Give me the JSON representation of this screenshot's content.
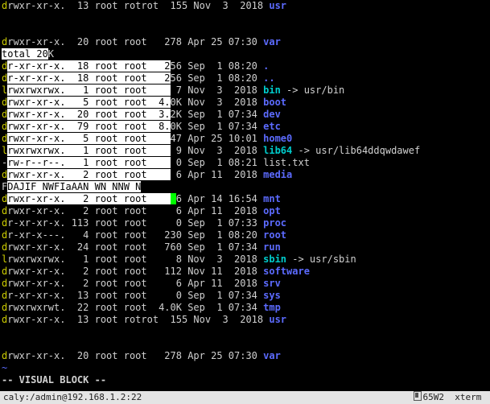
{
  "lines": [
    {
      "type": "dir",
      "d": "d",
      "sel0": false,
      "sel1": false,
      "perm": "rwxr-xr-x.  13 root rotrot  155 Nov  3  2018 ",
      "name": "usr",
      "nl": "blue"
    },
    {
      "type": "blank"
    },
    {
      "type": "blank"
    },
    {
      "type": "dir",
      "d": "d",
      "sel0": false,
      "sel1": false,
      "perm": "rwxr-xr-x.  20 root root   278 Apr 25 07:30 ",
      "name": "var",
      "nl": "blue"
    },
    {
      "type": "total",
      "text": "total 20",
      "sel": true,
      "tail": "K"
    },
    {
      "type": "dir",
      "d": "d",
      "sel0": true,
      "sel1": true,
      "perm": "r-xr-xr-x.  18 root root   2",
      "tail": "56 Sep  1 08:20 ",
      "name": ".",
      "nl": "blue"
    },
    {
      "type": "dir",
      "d": "d",
      "sel0": true,
      "sel1": true,
      "perm": "r-xr-xr-x.  18 root root   2",
      "tail": "56 Sep  1 08:20 ",
      "name": "..",
      "nl": "blue"
    },
    {
      "type": "link",
      "d": "l",
      "sel0": true,
      "sel1": true,
      "perm": "rwxrwxrwx.   1 root root    ",
      "tail": " 7 Nov  3  2018 ",
      "name": "bin",
      "arrow": " -> usr/bin",
      "nl": "cyan"
    },
    {
      "type": "dir",
      "d": "d",
      "sel0": true,
      "sel1": true,
      "perm": "rwxr-xr-x.   5 root root  4.",
      "tail": "0K Nov  3  2018 ",
      "name": "boot",
      "nl": "blue"
    },
    {
      "type": "dir",
      "d": "d",
      "sel0": true,
      "sel1": true,
      "perm": "rwxr-xr-x.  20 root root  3.",
      "tail": "2K Sep  1 07:34 ",
      "name": "dev",
      "nl": "blue"
    },
    {
      "type": "dir",
      "d": "d",
      "sel0": true,
      "sel1": true,
      "perm": "rwxr-xr-x.  79 root root  8.",
      "tail": "0K Sep  1 07:34 ",
      "name": "etc",
      "nl": "blue"
    },
    {
      "type": "dir",
      "d": "d",
      "sel0": true,
      "sel1": true,
      "perm": "rwxr-xr-x.   5 root root    ",
      "tail": "47 Apr 25 10:01 ",
      "name": "home0",
      "nl": "blue"
    },
    {
      "type": "link",
      "d": "l",
      "sel0": true,
      "sel1": true,
      "perm": "rwxrwxrwx.   1 root root    ",
      "tail": " 9 Nov  3  2018 ",
      "name": "lib64",
      "arrow": " -> usr/lib64ddqwdawef",
      "nl": "cyan"
    },
    {
      "type": "file",
      "d": "-",
      "sel0": true,
      "sel1": true,
      "perm": "rw-r--r--.   1 root root    ",
      "tail": " 0 Sep  1 08:21 list.txt"
    },
    {
      "type": "dir",
      "d": "d",
      "sel0": true,
      "sel1": true,
      "perm": "rwxr-xr-x.   2 root root    ",
      "tail": " 6 Apr 11  2018 ",
      "name": "media",
      "nl": "blue"
    },
    {
      "type": "garble",
      "text": "FDAJIF NWFIaAAN WN NNW N",
      "sel": true
    },
    {
      "type": "dir_cursor",
      "d": "d",
      "sel0": true,
      "sel1": true,
      "perm": "rwxr-xr-x.   2 root root    ",
      "curs": " ",
      "tail": "6 Apr 14 16:54 ",
      "name": "mnt",
      "nl": "blue"
    },
    {
      "type": "dir",
      "d": "d",
      "sel0": false,
      "sel1": false,
      "perm": "rwxr-xr-x.   2 root root     6 Apr 11  2018 ",
      "name": "opt",
      "nl": "blue"
    },
    {
      "type": "dir",
      "d": "d",
      "sel0": false,
      "sel1": false,
      "perm": "r-xr-xr-x. 113 root root     0 Sep  1 07:33 ",
      "name": "proc",
      "nl": "blue"
    },
    {
      "type": "dir",
      "d": "d",
      "sel0": false,
      "sel1": false,
      "perm": "r-xr-x---.   4 root root   230 Sep  1 08:20 ",
      "name": "root",
      "nl": "blue"
    },
    {
      "type": "dir",
      "d": "d",
      "sel0": false,
      "sel1": false,
      "perm": "rwxr-xr-x.  24 root root   760 Sep  1 07:34 ",
      "name": "run",
      "nl": "blue"
    },
    {
      "type": "link",
      "d": "l",
      "sel0": false,
      "sel1": false,
      "perm": "rwxrwxrwx.   1 root root     8 Nov  3  2018 ",
      "name": "sbin",
      "arrow": " -> usr/sbin",
      "nl": "cyan"
    },
    {
      "type": "dir",
      "d": "d",
      "sel0": false,
      "sel1": false,
      "perm": "rwxr-xr-x.   2 root root   112 Nov 11  2018 ",
      "name": "software",
      "nl": "blue"
    },
    {
      "type": "dir",
      "d": "d",
      "sel0": false,
      "sel1": false,
      "perm": "rwxr-xr-x.   2 root root     6 Apr 11  2018 ",
      "name": "srv",
      "nl": "blue"
    },
    {
      "type": "dir",
      "d": "d",
      "sel0": false,
      "sel1": false,
      "perm": "r-xr-xr-x.  13 root root     0 Sep  1 07:34 ",
      "name": "sys",
      "nl": "blue"
    },
    {
      "type": "dir",
      "d": "d",
      "sel0": false,
      "sel1": false,
      "perm": "rwxrwxrwt.  22 root root  4.0K Sep  1 07:34 ",
      "name": "tmp",
      "nl": "blue"
    },
    {
      "type": "dir",
      "d": "d",
      "sel0": false,
      "sel1": false,
      "perm": "rwxr-xr-x.  13 root rotrot  155 Nov  3  2018 ",
      "name": "usr",
      "nl": "blue"
    },
    {
      "type": "blank"
    },
    {
      "type": "blank"
    },
    {
      "type": "dir",
      "d": "d",
      "sel0": false,
      "sel1": false,
      "perm": "rwxr-xr-x.  20 root root   278 Apr 25 07:30 ",
      "name": "var",
      "nl": "blue"
    },
    {
      "type": "tilde",
      "text": "~"
    }
  ],
  "mode_line": "-- VISUAL BLOCK --",
  "status_left": "caly:/admin@192.168.1.2:22",
  "status_right_a": "65W2",
  "status_right_b": "xterm"
}
